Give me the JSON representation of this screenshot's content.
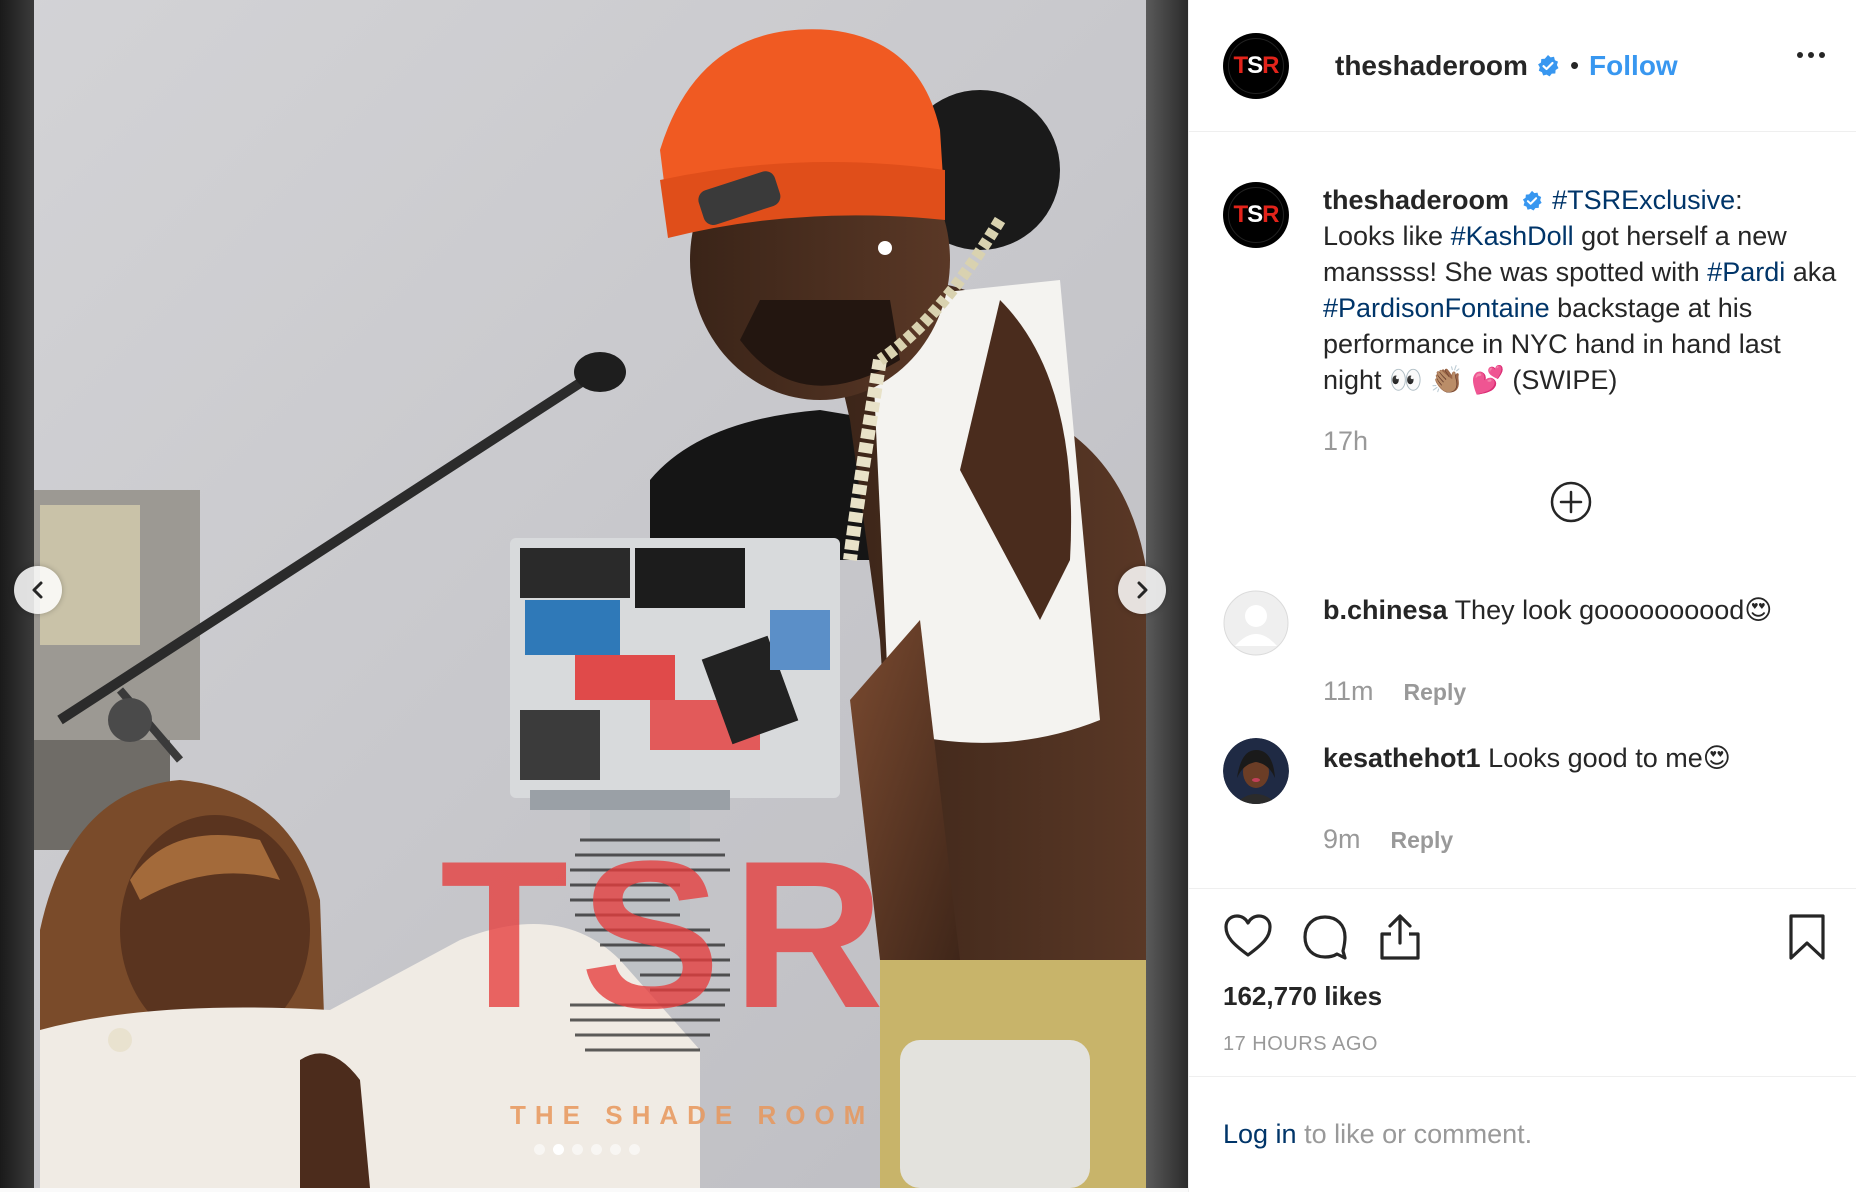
{
  "post": {
    "dots_count": 6,
    "active_dot": 1,
    "watermark": {
      "letters": "TSR",
      "caption": "THE SHADE ROOM"
    }
  },
  "header": {
    "avatar_text_t": "T",
    "avatar_text_s": "S",
    "avatar_text_r": "R",
    "username": "theshaderoom",
    "bullet": "•",
    "follow_label": "Follow",
    "more_icon": "more-options-icon"
  },
  "caption": {
    "username": "theshaderoom",
    "tag1": "#TSRExclusive",
    "text1": ":",
    "text2": "Looks like ",
    "tag2": "#KashDoll",
    "text3": " got herself a new manssss! She was spotted with ",
    "tag3": "#Pardi",
    "text4": " aka ",
    "tag4": "#PardisonFontaine",
    "text5": " backstage at his performance in NYC hand in hand last night 👀 👏🏽 💕  (SWIPE)",
    "time": "17h"
  },
  "comments": [
    {
      "username": "b.chinesa",
      "text": "They look goooooooood😍",
      "time": "11m",
      "reply_label": "Reply"
    },
    {
      "username": "kesathehot1",
      "text": "Looks good to me😍",
      "time": "9m",
      "reply_label": "Reply"
    }
  ],
  "actions": {
    "likes": "162,770 likes",
    "ago": "17 HOURS AGO"
  },
  "login": {
    "link": "Log in",
    "text": " to like or comment."
  },
  "colors": {
    "link_blue": "#3897f0",
    "hashtag": "#003569",
    "muted": "#999999",
    "verified": "#3897f0",
    "brand_red": "#e2231a"
  }
}
